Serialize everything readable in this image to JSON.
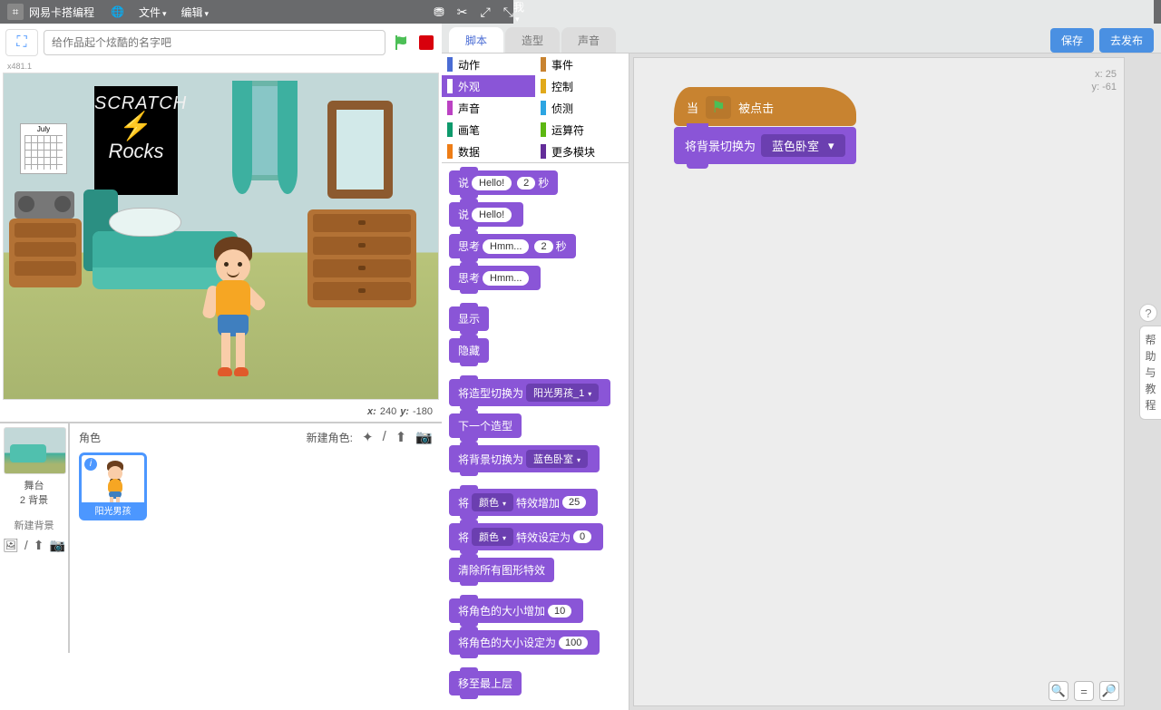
{
  "topbar": {
    "title": "网易卡搭编程",
    "menus": {
      "file": "文件",
      "edit": "编辑"
    },
    "right": "我"
  },
  "project": {
    "placeholder": "给作品起个炫酷的名字吧",
    "stage_size_hint": "x481.1"
  },
  "stage": {
    "poster_line1": "SCRATCH",
    "poster_line2": "Rocks",
    "calendar_month": "July",
    "coord_x_label": "x:",
    "coord_x": "240",
    "coord_y_label": "y:",
    "coord_y": "-180"
  },
  "sprite_panel": {
    "stage_label": "舞台",
    "backdrop_count": "2 背景",
    "new_backdrop": "新建背景",
    "sprites_label": "角色",
    "new_sprite": "新建角色:",
    "sprite1_name": "阳光男孩"
  },
  "tabs": {
    "scripts": "脚本",
    "costumes": "造型",
    "sounds": "声音"
  },
  "buttons": {
    "save": "保存",
    "publish": "去发布"
  },
  "categories": {
    "motion": "动作",
    "events": "事件",
    "looks": "外观",
    "control": "控制",
    "sound": "声音",
    "sensing": "侦测",
    "pen": "画笔",
    "operators": "运算符",
    "data": "数据",
    "more": "更多模块"
  },
  "cat_colors": {
    "motion": "#4a6cd4",
    "events": "#c88330",
    "looks": "#8a55d7",
    "control": "#e1a91a",
    "sound": "#bb42c3",
    "sensing": "#2ca5e2",
    "pen": "#0e9a6c",
    "operators": "#5cb712",
    "data": "#ee7d16",
    "more": "#632d99"
  },
  "blocks": {
    "say": "说",
    "hello": "Hello!",
    "secs": "秒",
    "two": "2",
    "think": "思考",
    "hmm": "Hmm...",
    "show": "显示",
    "hide": "隐藏",
    "switch_costume": "将造型切换为",
    "costume_opt": "阳光男孩_1",
    "next_costume": "下一个造型",
    "switch_backdrop": "将背景切换为",
    "backdrop_opt": "蓝色卧室",
    "change": "将",
    "color": "颜色",
    "effect_add": "特效增加",
    "v25": "25",
    "effect_set": "特效设定为",
    "v0": "0",
    "clear_effects": "清除所有图形特效",
    "size_add": "将角色的大小增加",
    "v10": "10",
    "size_set": "将角色的大小设定为",
    "v100": "100",
    "go_front": "移至最上层"
  },
  "script": {
    "when": "当",
    "clicked": "被点击",
    "switch_bg": "将背景切换为",
    "bg_opt": "蓝色卧室"
  },
  "watermark": {
    "x_label": "x:",
    "x": "25",
    "y_label": "y:",
    "y": "-61"
  },
  "help": {
    "text": "帮助与教程",
    "q": "?"
  }
}
